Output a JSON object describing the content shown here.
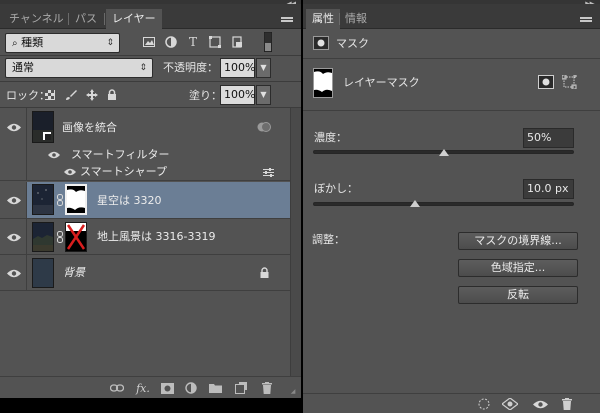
{
  "left_panel": {
    "tabs": [
      {
        "label": "チャンネル",
        "active": false
      },
      {
        "label": "パス",
        "active": false
      },
      {
        "label": "レイヤー",
        "active": true
      }
    ],
    "filter_dropdown": {
      "icon": "search-icon",
      "value": "種類"
    },
    "filter_icons": [
      "image-filter-icon",
      "adjustment-filter-icon",
      "type-filter-icon",
      "shape-filter-icon",
      "smart-object-filter-icon"
    ],
    "blend_mode": "通常",
    "opacity_label": "不透明度：",
    "opacity_value": "100%",
    "lock_label": "ロック：",
    "fill_label": "塗り：",
    "fill_value": "100%",
    "layers": [
      {
        "name": "画像を統合",
        "type": "smart-object",
        "visible": true
      },
      {
        "name": "スマートフィルター",
        "type": "smart-filter-group",
        "visible": true
      },
      {
        "name": "スマートシャープ",
        "type": "smart-filter",
        "visible": true
      },
      {
        "name": "星空は 3320",
        "type": "masked",
        "visible": true,
        "selected": true
      },
      {
        "name": "地上風景は 3316-3319",
        "type": "masked",
        "visible": true
      },
      {
        "name": "背景",
        "type": "background",
        "visible": true,
        "locked": true
      }
    ],
    "footer_icons": [
      "link-icon",
      "fx-icon",
      "add-mask-icon",
      "new-adjustment-icon",
      "new-group-icon",
      "new-layer-icon",
      "trash-icon"
    ],
    "footer_fx_label": "fx."
  },
  "right_panel": {
    "tabs": [
      {
        "label": "属性",
        "active": true
      },
      {
        "label": "情報",
        "active": false
      }
    ],
    "header_title": "マスク",
    "mask_type_label": "レイヤーマスク",
    "density": {
      "label": "濃度：",
      "value": "50%",
      "fraction": 0.5
    },
    "feather": {
      "label": "ぼかし：",
      "value": "10.0 px",
      "fraction": 0.39
    },
    "adjust_label": "調整：",
    "buttons": [
      "マスクの境界線...",
      "色域指定...",
      "反転"
    ],
    "footer_icons": [
      "load-selection-icon",
      "apply-mask-icon",
      "toggle-mask-icon",
      "delete-mask-icon"
    ]
  },
  "colors": {
    "panel_bg": "#535353",
    "tab_bg": "#3a3a3a",
    "selected_layer": "#6b7e95",
    "mask_red_x": "#d81e1e"
  }
}
